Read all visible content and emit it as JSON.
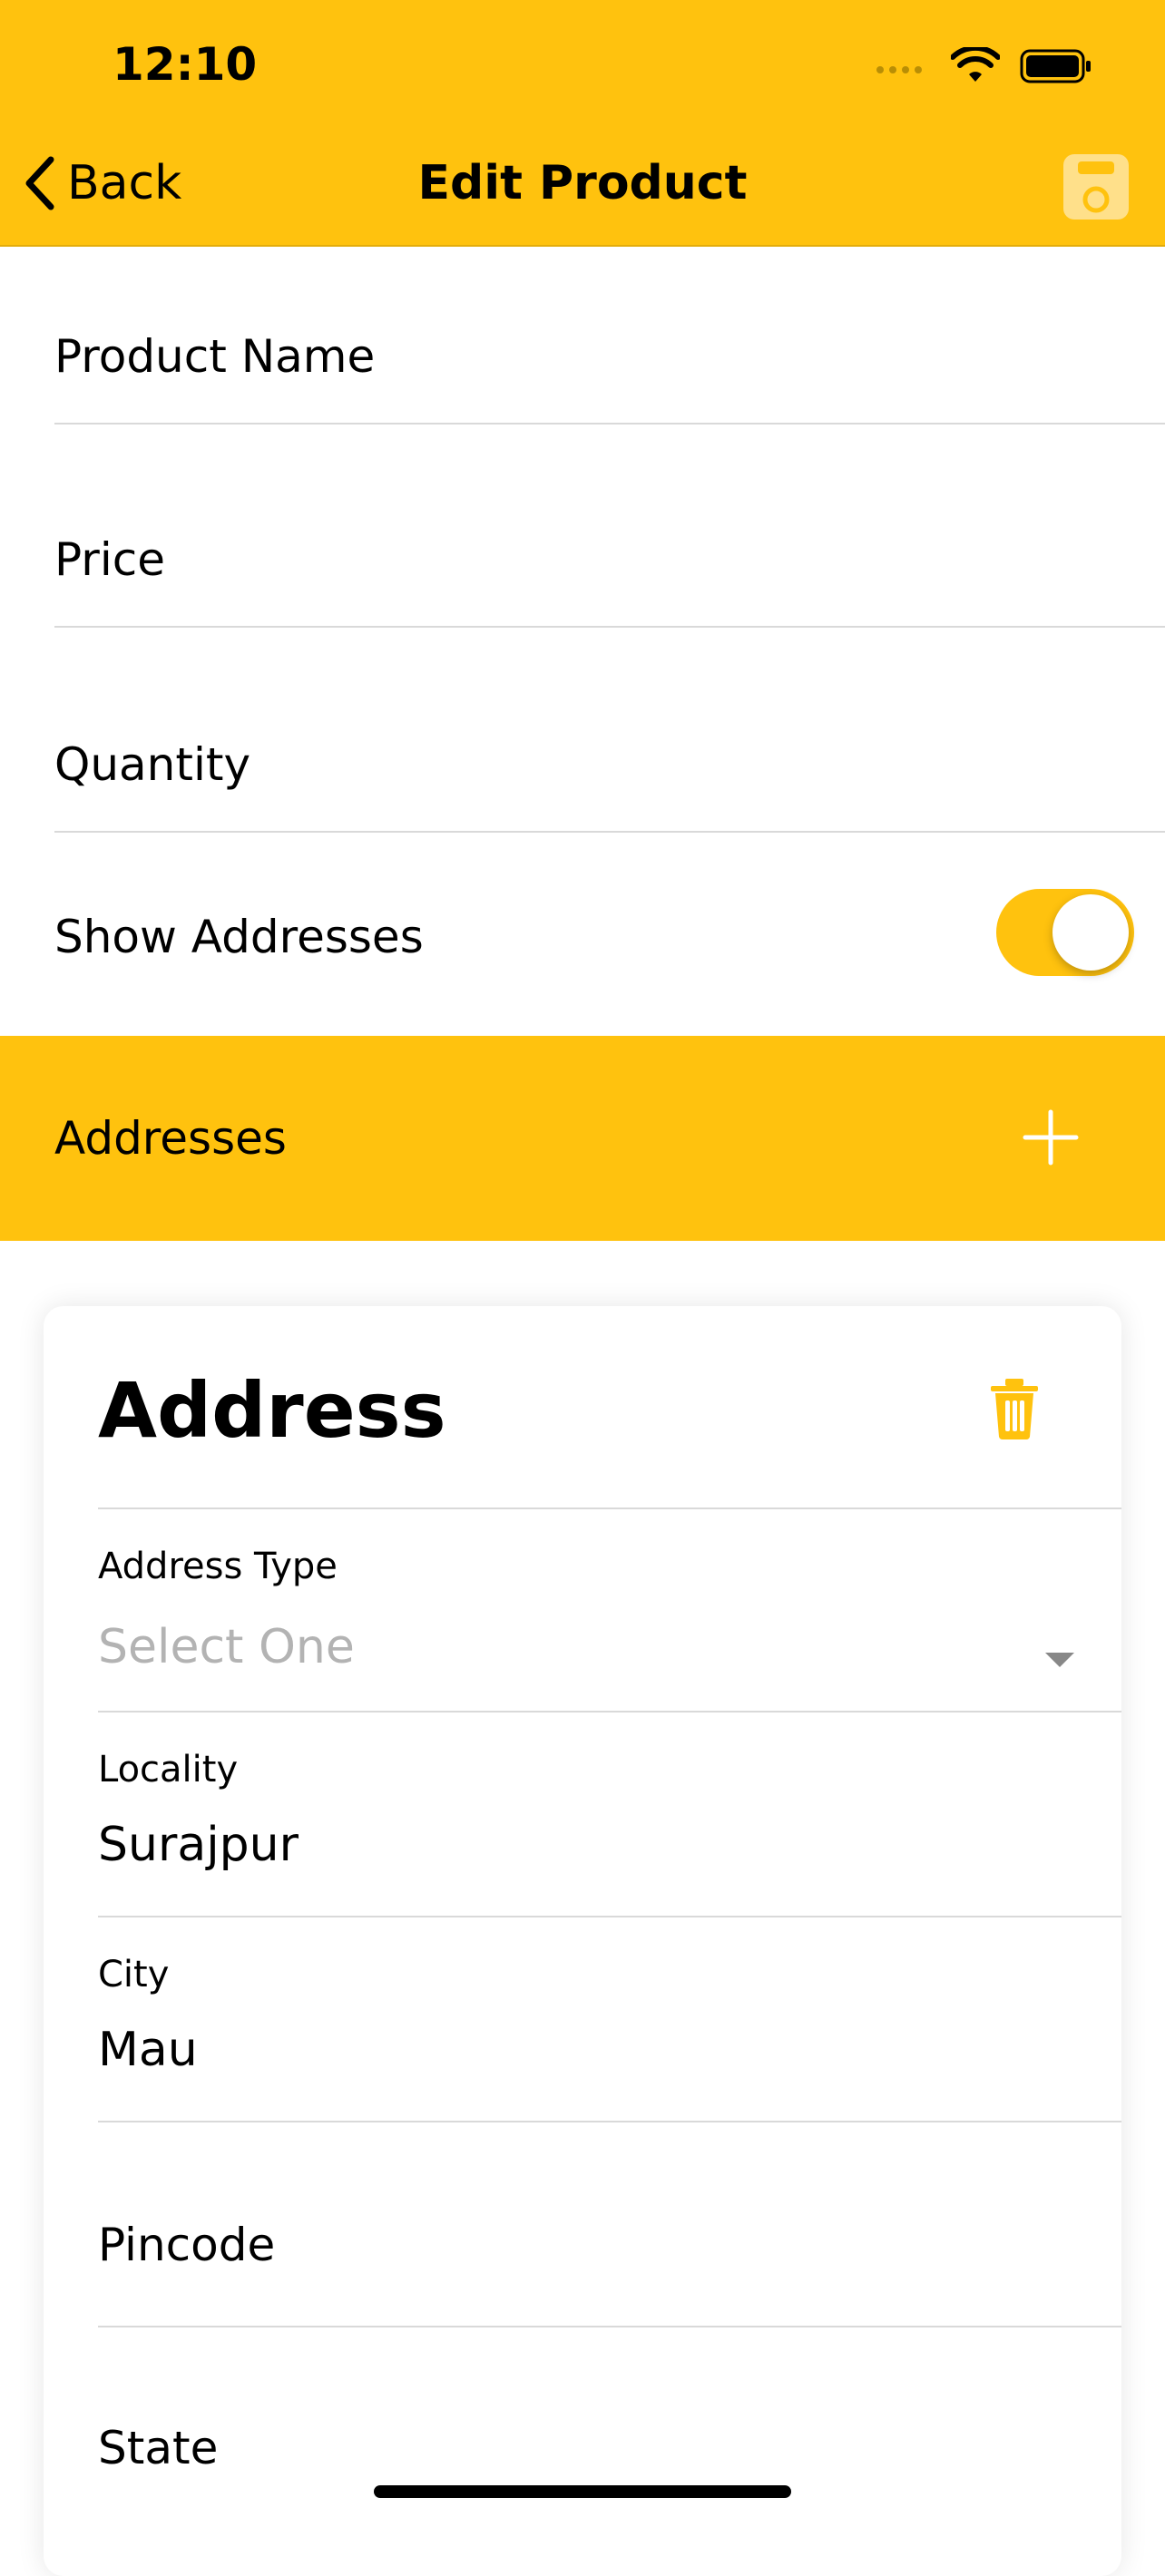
{
  "status_bar": {
    "time": "12:10"
  },
  "nav": {
    "back_label": "Back",
    "title": "Edit Product",
    "save_icon": "save-icon"
  },
  "form": {
    "product_name_label": "Product Name",
    "price_label": "Price",
    "quantity_label": "Quantity",
    "show_addresses_label": "Show Addresses",
    "show_addresses_on": true
  },
  "addresses_section": {
    "label": "Addresses",
    "add_icon": "plus-icon"
  },
  "address_card": {
    "title": "Address",
    "delete_icon": "trash-icon",
    "address_type_label": "Address Type",
    "address_type_placeholder": "Select One",
    "locality_label": "Locality",
    "locality_value": "Surajpur",
    "city_label": "City",
    "city_value": "Mau",
    "pincode_label": "Pincode",
    "state_label": "State"
  },
  "colors": {
    "accent": "#FFC20E",
    "text": "#000000",
    "placeholder": "#B3B3B3",
    "divider": "#D9D9D9"
  }
}
